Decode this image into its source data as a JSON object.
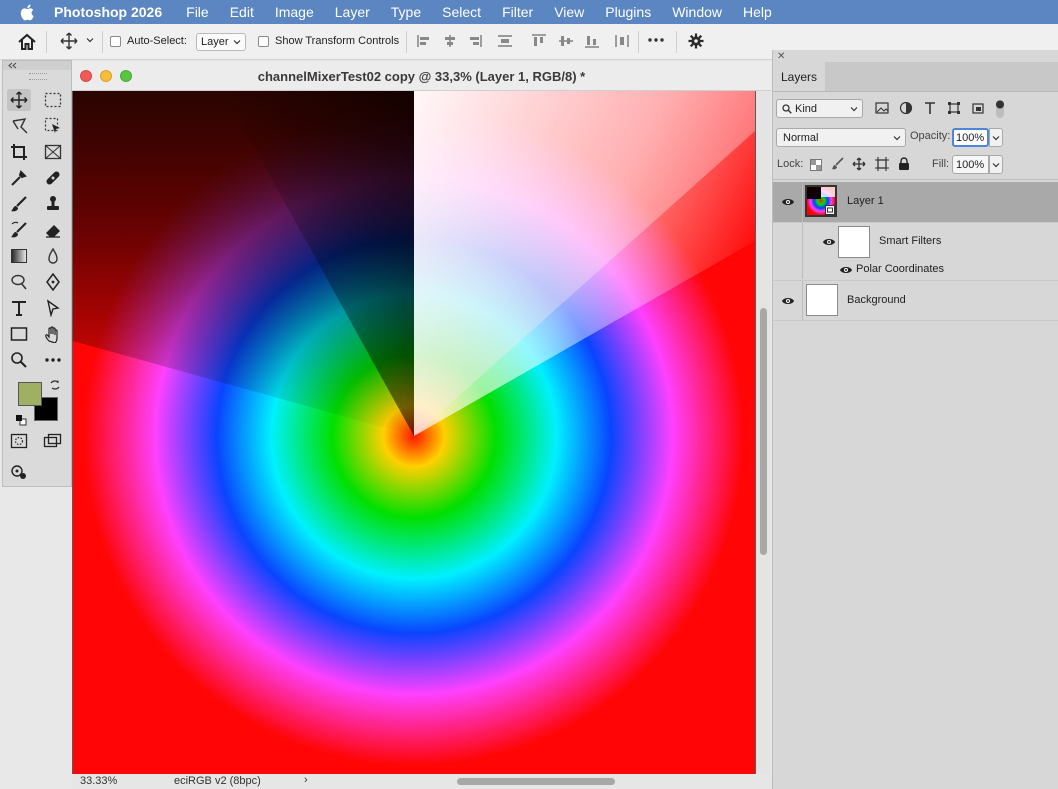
{
  "menubar": {
    "app": "Photoshop 2026",
    "items": [
      "File",
      "Edit",
      "Image",
      "Layer",
      "Type",
      "Select",
      "Filter",
      "View",
      "Plugins",
      "Window",
      "Help"
    ]
  },
  "options": {
    "auto_select_label": "Auto-Select:",
    "auto_select_value": "Layer",
    "transform_label": "Show Transform Controls"
  },
  "document": {
    "title": "channelMixerTest02 copy @ 33,3% (Layer 1, RGB/8) *",
    "zoom": "33.33%",
    "profile": "eciRGB v2 (8bpc)",
    "profile_arrow": "›"
  },
  "layers_panel": {
    "tab": "Layers",
    "kind_value": "Kind",
    "blend_mode": "Normal",
    "opacity_label": "Opacity:",
    "opacity_value": "100%",
    "lock_label": "Lock:",
    "fill_label": "Fill:",
    "fill_value": "100%",
    "layers": [
      {
        "name": "Layer 1",
        "selected": true
      },
      {
        "name": "Smart Filters"
      },
      {
        "name": "Polar Coordinates"
      },
      {
        "name": "Background"
      }
    ]
  },
  "colors": {
    "menubar_bg": "#5b86c1",
    "foreground_color": "#9fb063",
    "background_color": "#000000",
    "selected_layer_bg": "#a9a9a9"
  }
}
